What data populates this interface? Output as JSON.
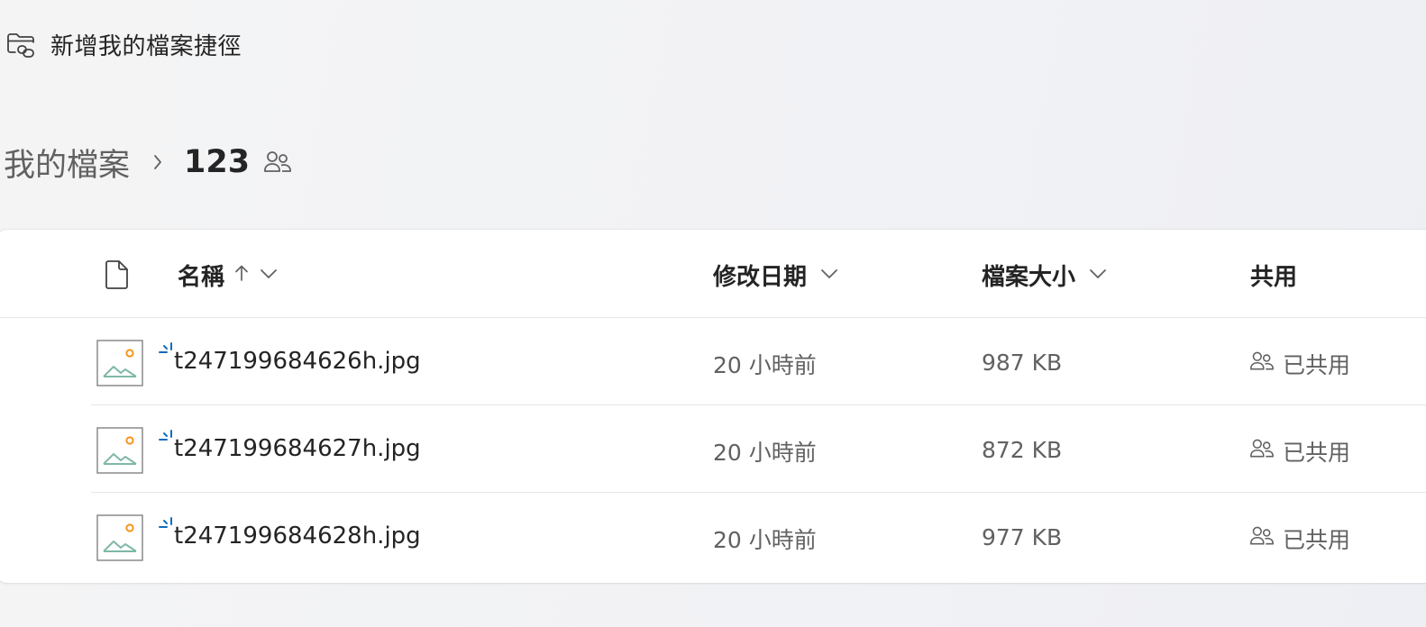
{
  "toolbar": {
    "add_shortcut_label": "新增我的檔案捷徑",
    "add_shortcut_icon": "folder-link-icon"
  },
  "breadcrumb": {
    "root": "我的檔案",
    "separator_icon": "chevron-right-icon",
    "current": "123",
    "shared_icon": "people-icon"
  },
  "list": {
    "columns": {
      "filetype_icon": "document-icon",
      "name": "名稱",
      "name_sort_icon": "arrow-up-icon",
      "modified": "修改日期",
      "size": "檔案大小",
      "sharing": "共用"
    },
    "rows": [
      {
        "name": "t247199684626h.jpg",
        "modified": "20 小時前",
        "size": "987 KB",
        "sharing": "已共用"
      },
      {
        "name": "t247199684627h.jpg",
        "modified": "20 小時前",
        "size": "872 KB",
        "sharing": "已共用"
      },
      {
        "name": "t247199684628h.jpg",
        "modified": "20 小時前",
        "size": "977 KB",
        "sharing": "已共用"
      }
    ]
  },
  "colors": {
    "new_indicator": "#0f6cbd",
    "thumb_sun": "#f7941d",
    "thumb_hills": "#7fb8a8"
  }
}
